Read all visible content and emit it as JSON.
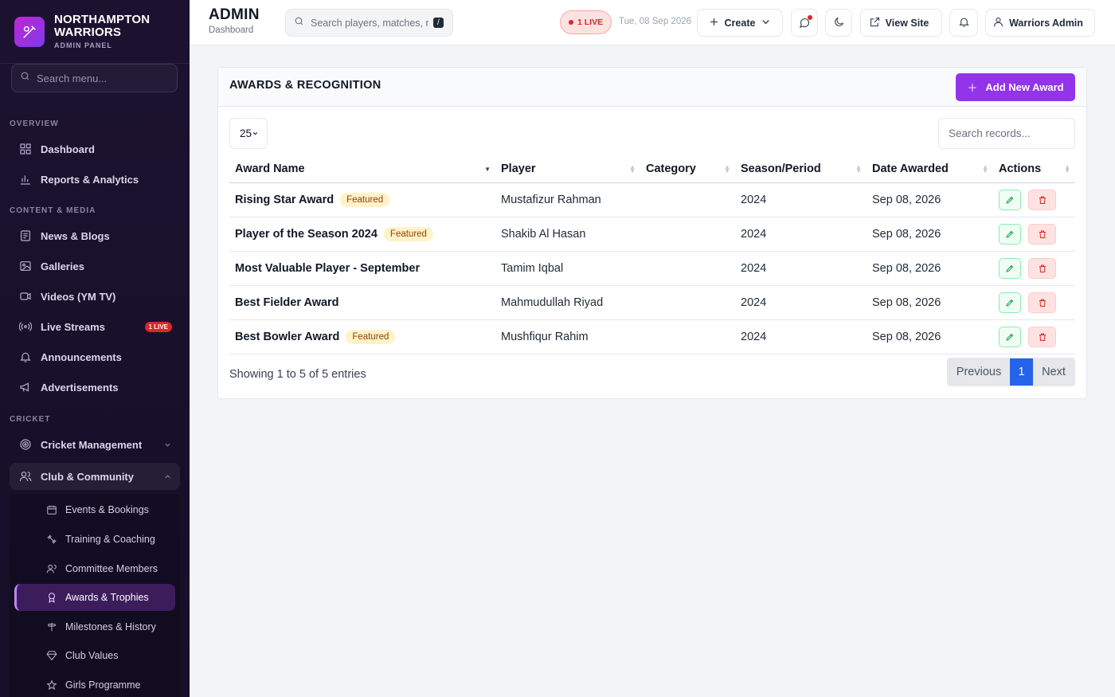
{
  "brand": {
    "title_line1": "NORTHAMPTON",
    "title_line2": "WARRIORS",
    "subtitle": "ADMIN PANEL"
  },
  "sidebar": {
    "search_placeholder": "Search menu...",
    "sections": {
      "overview": "OVERVIEW",
      "content": "CONTENT & MEDIA",
      "cricket": "CRICKET"
    },
    "items": {
      "dashboard": "Dashboard",
      "reports": "Reports & Analytics",
      "news": "News & Blogs",
      "galleries": "Galleries",
      "videos": "Videos (YM TV)",
      "live": "Live Streams",
      "live_badge": "1 LIVE",
      "announcements": "Announcements",
      "ads": "Advertisements",
      "cricket_mgmt": "Cricket Management",
      "club": "Club & Community"
    },
    "sub_items": {
      "events": "Events & Bookings",
      "training": "Training & Coaching",
      "committee": "Committee Members",
      "awards": "Awards & Trophies",
      "milestones": "Milestones & History",
      "values": "Club Values",
      "girls": "Girls Programme"
    }
  },
  "header": {
    "title": "ADMIN",
    "subtitle": "Dashboard",
    "search_placeholder": "Search players, matches, n",
    "kbd": "/",
    "live": "1 LIVE",
    "date": "Tue, 08 Sep 2026",
    "create": "Create",
    "view_site": "View Site",
    "user": "Warriors Admin"
  },
  "card": {
    "title": "AWARDS & RECOGNITION",
    "add_button": "Add New Award",
    "page_length": "25",
    "search_placeholder": "Search records...",
    "columns": [
      "Award Name",
      "Player",
      "Category",
      "Season/Period",
      "Date Awarded",
      "Actions"
    ],
    "featured_label": "Featured",
    "rows": [
      {
        "name": "Rising Star Award",
        "featured": true,
        "player": "Mustafizur Rahman",
        "category": "",
        "season": "2024",
        "date": "Sep 08, 2026"
      },
      {
        "name": "Player of the Season 2024",
        "featured": true,
        "player": "Shakib Al Hasan",
        "category": "",
        "season": "2024",
        "date": "Sep 08, 2026"
      },
      {
        "name": "Most Valuable Player - September",
        "featured": false,
        "player": "Tamim Iqbal",
        "category": "",
        "season": "2024",
        "date": "Sep 08, 2026"
      },
      {
        "name": "Best Fielder Award",
        "featured": false,
        "player": "Mahmudullah Riyad",
        "category": "",
        "season": "2024",
        "date": "Sep 08, 2026"
      },
      {
        "name": "Best Bowler Award",
        "featured": true,
        "player": "Mushfiqur Rahim",
        "category": "",
        "season": "2024",
        "date": "Sep 08, 2026"
      }
    ],
    "showing": "Showing 1 to 5 of 5 entries",
    "pager": {
      "prev": "Previous",
      "page": "1",
      "next": "Next"
    }
  },
  "colors": {
    "accent": "#9333ea",
    "sidebar_bg": "#1c1230",
    "live": "#dc2626",
    "page_active": "#2563eb"
  }
}
